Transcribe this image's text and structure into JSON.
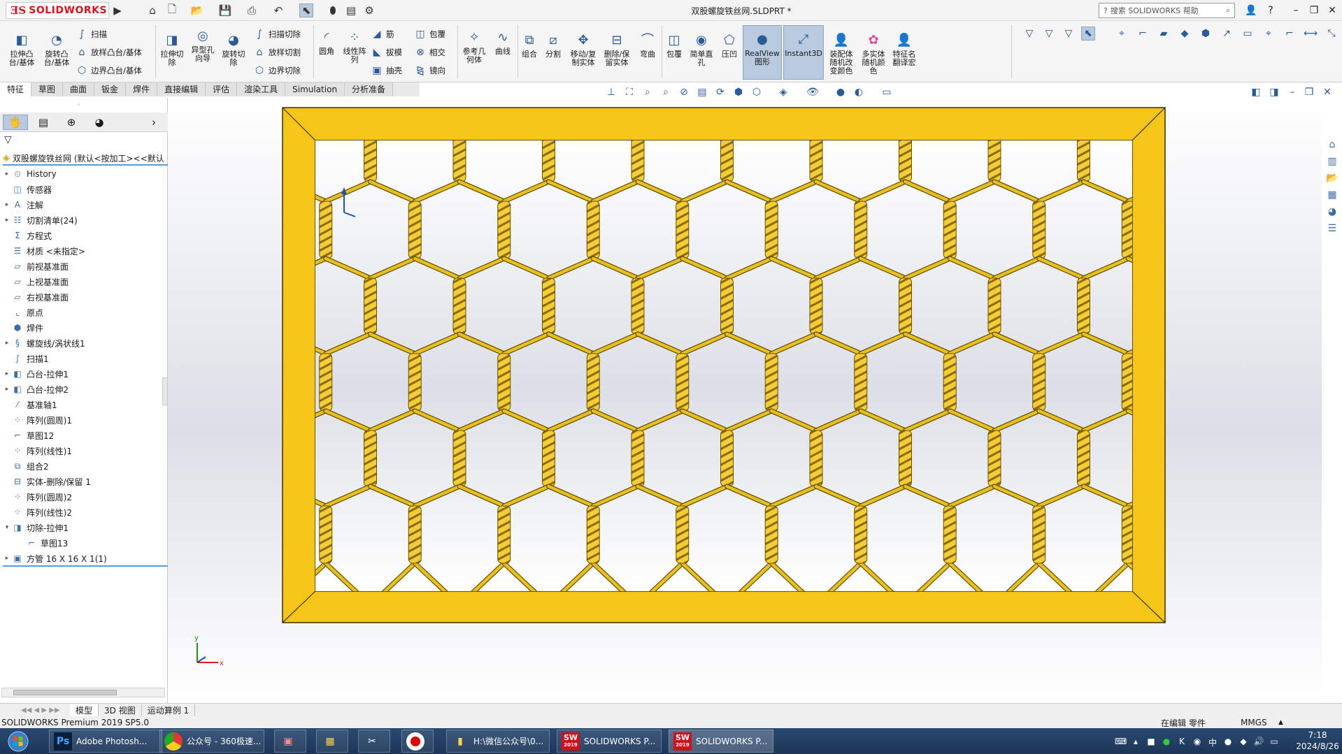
{
  "app": {
    "brand": "SOLIDWORKS",
    "document_title": "双股螺旋铁丝网.SLDPRT *",
    "help_search_placeholder": "搜索 SOLIDWORKS 帮助"
  },
  "commands": {
    "extrude_boss": "拉伸凸台/基体",
    "revolve_boss": "旋转凸台/基体",
    "sweep": "扫描",
    "loft_boss": "放样凸台/基体",
    "boundary_boss": "边界凸台/基体",
    "extrude_cut": "拉伸切除",
    "hole_wizard": "异型孔向导",
    "revolve_cut": "旋转切除",
    "sweep_cut": "扫描切除",
    "loft_cut": "放样切割",
    "boundary_cut": "边界切除",
    "fillet": "圆角",
    "linear_pattern": "线性阵列",
    "rib": "筋",
    "draft": "拔模",
    "shell": "抽壳",
    "wrap": "包覆",
    "intersect": "相交",
    "mirror": "镜向",
    "ref_geometry": "参考几何体",
    "curves": "曲线",
    "combine": "组合",
    "split": "分割",
    "move_copy": "移动/复制实体",
    "delete_keep": "删除/保留实体",
    "flex": "弯曲",
    "wrap2": "包覆",
    "simple_hole": "简单直孔",
    "indent": "压凹",
    "realview": "RealView图形",
    "instant3d": "Instant3D",
    "asm_random_color": "装配体随机改变颜色",
    "multibody_random_color": "多实体随机颜色",
    "feature_translate": "特征名翻译宏"
  },
  "tabs": [
    "特征",
    "草图",
    "曲面",
    "钣金",
    "焊件",
    "直接编辑",
    "评估",
    "渲染工具",
    "Simulation",
    "分析准备"
  ],
  "tree": {
    "root": "双股螺旋铁丝网 (默认<按加工><<默认",
    "items": [
      {
        "label": "History",
        "expandable": true,
        "icon": "history-icon"
      },
      {
        "label": "传感器",
        "expandable": false,
        "icon": "sensor-icon"
      },
      {
        "label": "注解",
        "expandable": true,
        "icon": "annotation-icon"
      },
      {
        "label": "切割清单(24)",
        "expandable": true,
        "icon": "cutlist-icon"
      },
      {
        "label": "方程式",
        "expandable": false,
        "icon": "equation-icon"
      },
      {
        "label": "材质 <未指定>",
        "expandable": false,
        "icon": "material-icon"
      },
      {
        "label": "前视基准面",
        "expandable": false,
        "icon": "plane-icon"
      },
      {
        "label": "上视基准面",
        "expandable": false,
        "icon": "plane-icon"
      },
      {
        "label": "右视基准面",
        "expandable": false,
        "icon": "plane-icon"
      },
      {
        "label": "原点",
        "expandable": false,
        "icon": "origin-icon"
      },
      {
        "label": "焊件",
        "expandable": false,
        "icon": "weldment-icon"
      },
      {
        "label": "螺旋线/涡状线1",
        "expandable": true,
        "icon": "helix-icon"
      },
      {
        "label": "扫描1",
        "expandable": false,
        "icon": "sweep-icon"
      },
      {
        "label": "凸台-拉伸1",
        "expandable": true,
        "icon": "extrude-icon"
      },
      {
        "label": "凸台-拉伸2",
        "expandable": true,
        "icon": "extrude-icon"
      },
      {
        "label": "基准轴1",
        "expandable": false,
        "icon": "axis-icon"
      },
      {
        "label": "阵列(圆周)1",
        "expandable": false,
        "icon": "pattern-icon"
      },
      {
        "label": "草图12",
        "expandable": false,
        "icon": "sketch-icon"
      },
      {
        "label": "阵列(线性)1",
        "expandable": false,
        "icon": "pattern-icon"
      },
      {
        "label": "组合2",
        "expandable": false,
        "icon": "combine-icon"
      },
      {
        "label": "实体-删除/保留 1",
        "expandable": false,
        "icon": "delete-body-icon"
      },
      {
        "label": "阵列(圆周)2",
        "expandable": false,
        "icon": "pattern-icon"
      },
      {
        "label": "阵列(线性)2",
        "expandable": false,
        "icon": "pattern-icon"
      },
      {
        "label": "切除-拉伸1",
        "expandable": true,
        "expanded": true,
        "icon": "cut-icon"
      },
      {
        "label": "草图13",
        "expandable": false,
        "indent": true,
        "icon": "sketch-icon"
      },
      {
        "label": "方管 16 X 16 X 1(1)",
        "expandable": true,
        "icon": "structure-icon"
      }
    ]
  },
  "bottom_tabs": [
    "模型",
    "3D 视图",
    "运动算例 1"
  ],
  "status": {
    "version": "SOLIDWORKS Premium 2019 SP5.0",
    "mode": "在编辑 零件",
    "units": "MMGS"
  },
  "taskbar": {
    "items": [
      {
        "label": "Adobe Photosh...",
        "icon": "photoshop-icon"
      },
      {
        "label": "公众号 - 360极速...",
        "icon": "browser-icon"
      },
      {
        "label": "H:\\微信公众号\\0...",
        "icon": "folder-icon"
      },
      {
        "label": "SOLIDWORKS P...",
        "icon": "solidworks-icon"
      },
      {
        "label": "SOLIDWORKS P...",
        "icon": "solidworks-icon"
      }
    ],
    "sw_year": "2019",
    "time": "7:18",
    "date": "2024/8/26"
  },
  "model": {
    "frame_color": "#f5c518",
    "mesh_color": "#e8c020",
    "triad_x": "x",
    "triad_y": "y"
  }
}
